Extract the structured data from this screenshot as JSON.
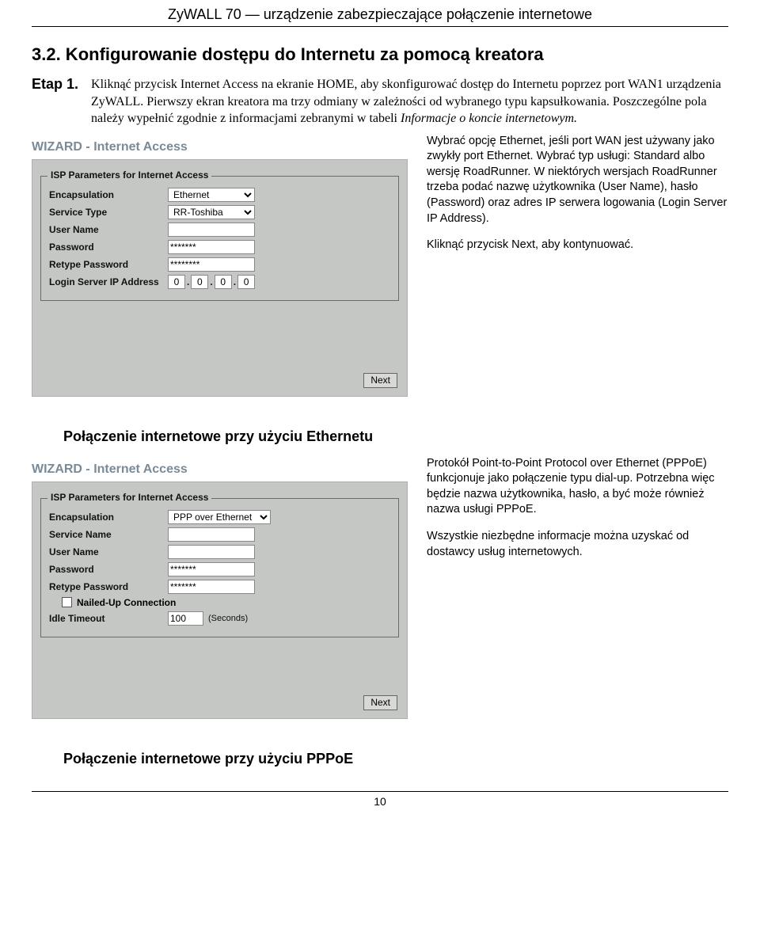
{
  "headerTitle": "ZyWALL 70 — urządzenie zabezpieczające połączenie internetowe",
  "sectionHeading": "3.2. Konfigurowanie dostępu do Internetu za pomocą kreatora",
  "etapLabel": "Etap 1.",
  "introText": "Kliknąć przycisk Internet Access na ekranie HOME, aby skonfigurować dostęp do Internetu poprzez port WAN1 urządzenia ZyWALL. Pierwszy ekran kreatora ma trzy odmiany w zależności od wybranego typu kapsułkowania. Poszczególne pola należy wypełnić zgodnie z informacjami zebranymi w tabeli ",
  "introItalic": "Informacje o koncie internetowym.",
  "panel1": {
    "wizardTitle": "WIZARD - Internet Access",
    "legend": "ISP Parameters for Internet Access",
    "labels": {
      "encap": "Encapsulation",
      "service": "Service Type",
      "user": "User Name",
      "pass": "Password",
      "retype": "Retype Password",
      "loginIp": "Login Server IP Address"
    },
    "values": {
      "encap": "Ethernet",
      "service": "RR-Toshiba",
      "user": "",
      "pass": "*******",
      "retype": "********",
      "ip": [
        "0",
        "0",
        "0",
        "0"
      ]
    },
    "nextBtn": "Next"
  },
  "desc1p1": "Wybrać opcję Ethernet, jeśli port WAN jest używany jako zwykły port Ethernet. Wybrać typ usługi: Standard albo wersję RoadRunner. W niektórych wersjach RoadRunner trzeba podać nazwę użytkownika (User Name), hasło (Password) oraz adres IP serwera logowania (Login Server IP Address).",
  "desc1p2": "Kliknąć przycisk Next, aby kontynuować.",
  "subHeading1": "Połączenie internetowe przy użyciu Ethernetu",
  "panel2": {
    "wizardTitle": "WIZARD - Internet Access",
    "legend": "ISP Parameters for Internet Access",
    "labels": {
      "encap": "Encapsulation",
      "svcName": "Service Name",
      "user": "User Name",
      "pass": "Password",
      "retype": "Retype Password",
      "nailed": "Nailed-Up Connection",
      "idle": "Idle Timeout"
    },
    "values": {
      "encap": "PPP over Ethernet",
      "svcName": "",
      "user": "",
      "pass": "*******",
      "retype": "*******",
      "idle": "100",
      "idleUnit": "(Seconds)"
    },
    "nextBtn": "Next"
  },
  "desc2p1": "Protokół Point-to-Point Protocol over Ethernet (PPPoE) funkcjonuje jako połączenie typu dial-up. Potrzebna więc będzie nazwa użytkownika, hasło, a być może również nazwa usługi PPPoE.",
  "desc2p2": "Wszystkie niezbędne informacje można uzyskać od dostawcy usług internetowych.",
  "subHeading2": "Połączenie internetowe przy użyciu PPPoE",
  "pageNum": "10"
}
